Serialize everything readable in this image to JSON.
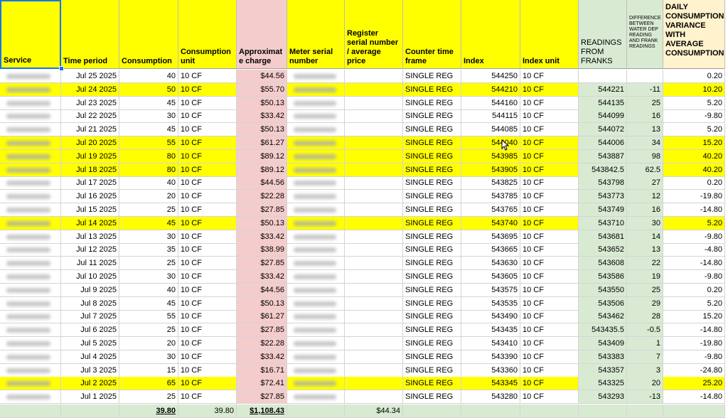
{
  "columns": [
    {
      "key": "service",
      "label": "Service"
    },
    {
      "key": "period",
      "label": "Time period"
    },
    {
      "key": "consumption",
      "label": "Consumption"
    },
    {
      "key": "unit",
      "label": "Consumption unit"
    },
    {
      "key": "charge",
      "label": "Approximat e charge"
    },
    {
      "key": "meter",
      "label": "Meter serial number"
    },
    {
      "key": "register",
      "label": "Register serial number / average price"
    },
    {
      "key": "counter",
      "label": "Counter time frame"
    },
    {
      "key": "index",
      "label": "Index"
    },
    {
      "key": "index_unit",
      "label": "Index unit"
    },
    {
      "key": "franks",
      "label": "READINGS FROM FRANKS"
    },
    {
      "key": "diff",
      "label": "DIFFERENCE BETWEEN WATER DEP READING AND FRANK READINGS"
    },
    {
      "key": "variance",
      "label": "DAILY CONSUMPTION VARIANCE WITH AVERAGE CONSUMPTION"
    }
  ],
  "rows": [
    {
      "period": "Jul 25 2025",
      "consumption": "40",
      "unit": "10 CF",
      "charge": "$44.56",
      "counter": "SINGLE REG",
      "index": "544250",
      "index_unit": "10 CF",
      "franks": "",
      "diff": "",
      "variance": "0.20",
      "hl": false
    },
    {
      "period": "Jul 24 2025",
      "consumption": "50",
      "unit": "10 CF",
      "charge": "$55.70",
      "counter": "SINGLE REG",
      "index": "544210",
      "index_unit": "10 CF",
      "franks": "544221",
      "diff": "-11",
      "variance": "10.20",
      "hl": true
    },
    {
      "period": "Jul 23 2025",
      "consumption": "45",
      "unit": "10 CF",
      "charge": "$50.13",
      "counter": "SINGLE REG",
      "index": "544160",
      "index_unit": "10 CF",
      "franks": "544135",
      "diff": "25",
      "variance": "5.20",
      "hl": false
    },
    {
      "period": "Jul 22 2025",
      "consumption": "30",
      "unit": "10 CF",
      "charge": "$33.42",
      "counter": "SINGLE REG",
      "index": "544115",
      "index_unit": "10 CF",
      "franks": "544099",
      "diff": "16",
      "variance": "-9.80",
      "hl": false
    },
    {
      "period": "Jul 21 2025",
      "consumption": "45",
      "unit": "10 CF",
      "charge": "$50.13",
      "counter": "SINGLE REG",
      "index": "544085",
      "index_unit": "10 CF",
      "franks": "544072",
      "diff": "13",
      "variance": "5.20",
      "hl": false
    },
    {
      "period": "Jul 20 2025",
      "consumption": "55",
      "unit": "10 CF",
      "charge": "$61.27",
      "counter": "SINGLE REG",
      "index": "544040",
      "index_unit": "10 CF",
      "franks": "544006",
      "diff": "34",
      "variance": "15.20",
      "hl": true
    },
    {
      "period": "Jul 19 2025",
      "consumption": "80",
      "unit": "10 CF",
      "charge": "$89.12",
      "counter": "SINGLE REG",
      "index": "543985",
      "index_unit": "10 CF",
      "franks": "543887",
      "diff": "98",
      "variance": "40.20",
      "hl": true
    },
    {
      "period": "Jul 18 2025",
      "consumption": "80",
      "unit": "10 CF",
      "charge": "$89.12",
      "counter": "SINGLE REG",
      "index": "543905",
      "index_unit": "10 CF",
      "franks": "543842.5",
      "diff": "62.5",
      "variance": "40.20",
      "hl": true
    },
    {
      "period": "Jul 17 2025",
      "consumption": "40",
      "unit": "10 CF",
      "charge": "$44.56",
      "counter": "SINGLE REG",
      "index": "543825",
      "index_unit": "10 CF",
      "franks": "543798",
      "diff": "27",
      "variance": "0.20",
      "hl": false
    },
    {
      "period": "Jul 16 2025",
      "consumption": "20",
      "unit": "10 CF",
      "charge": "$22.28",
      "counter": "SINGLE REG",
      "index": "543785",
      "index_unit": "10 CF",
      "franks": "543773",
      "diff": "12",
      "variance": "-19.80",
      "hl": false
    },
    {
      "period": "Jul 15 2025",
      "consumption": "25",
      "unit": "10 CF",
      "charge": "$27.85",
      "counter": "SINGLE REG",
      "index": "543765",
      "index_unit": "10 CF",
      "franks": "543749",
      "diff": "16",
      "variance": "-14.80",
      "hl": false
    },
    {
      "period": "Jul 14 2025",
      "consumption": "45",
      "unit": "10 CF",
      "charge": "$50.13",
      "counter": "SINGLE REG",
      "index": "543740",
      "index_unit": "10 CF",
      "franks": "543710",
      "diff": "30",
      "variance": "5.20",
      "hl": true
    },
    {
      "period": "Jul 13 2025",
      "consumption": "30",
      "unit": "10 CF",
      "charge": "$33.42",
      "counter": "SINGLE REG",
      "index": "543695",
      "index_unit": "10 CF",
      "franks": "543681",
      "diff": "14",
      "variance": "-9.80",
      "hl": false
    },
    {
      "period": "Jul 12 2025",
      "consumption": "35",
      "unit": "10 CF",
      "charge": "$38.99",
      "counter": "SINGLE REG",
      "index": "543665",
      "index_unit": "10 CF",
      "franks": "543652",
      "diff": "13",
      "variance": "-4.80",
      "hl": false
    },
    {
      "period": "Jul 11 2025",
      "consumption": "25",
      "unit": "10 CF",
      "charge": "$27.85",
      "counter": "SINGLE REG",
      "index": "543630",
      "index_unit": "10 CF",
      "franks": "543608",
      "diff": "22",
      "variance": "-14.80",
      "hl": false
    },
    {
      "period": "Jul 10 2025",
      "consumption": "30",
      "unit": "10 CF",
      "charge": "$33.42",
      "counter": "SINGLE REG",
      "index": "543605",
      "index_unit": "10 CF",
      "franks": "543586",
      "diff": "19",
      "variance": "-9.80",
      "hl": false
    },
    {
      "period": "Jul 9 2025",
      "consumption": "40",
      "unit": "10 CF",
      "charge": "$44.56",
      "counter": "SINGLE REG",
      "index": "543575",
      "index_unit": "10 CF",
      "franks": "543550",
      "diff": "25",
      "variance": "0.20",
      "hl": false
    },
    {
      "period": "Jul 8 2025",
      "consumption": "45",
      "unit": "10 CF",
      "charge": "$50.13",
      "counter": "SINGLE REG",
      "index": "543535",
      "index_unit": "10 CF",
      "franks": "543506",
      "diff": "29",
      "variance": "5.20",
      "hl": false
    },
    {
      "period": "Jul 7 2025",
      "consumption": "55",
      "unit": "10 CF",
      "charge": "$61.27",
      "counter": "SINGLE REG",
      "index": "543490",
      "index_unit": "10 CF",
      "franks": "543462",
      "diff": "28",
      "variance": "15.20",
      "hl": false
    },
    {
      "period": "Jul 6 2025",
      "consumption": "25",
      "unit": "10 CF",
      "charge": "$27.85",
      "counter": "SINGLE REG",
      "index": "543435",
      "index_unit": "10 CF",
      "franks": "543435.5",
      "diff": "-0.5",
      "variance": "-14.80",
      "hl": false
    },
    {
      "period": "Jul 5 2025",
      "consumption": "20",
      "unit": "10 CF",
      "charge": "$22.28",
      "counter": "SINGLE REG",
      "index": "543410",
      "index_unit": "10 CF",
      "franks": "543409",
      "diff": "1",
      "variance": "-19.80",
      "hl": false
    },
    {
      "period": "Jul 4 2025",
      "consumption": "30",
      "unit": "10 CF",
      "charge": "$33.42",
      "counter": "SINGLE REG",
      "index": "543390",
      "index_unit": "10 CF",
      "franks": "543383",
      "diff": "7",
      "variance": "-9.80",
      "hl": false
    },
    {
      "period": "Jul 3 2025",
      "consumption": "15",
      "unit": "10 CF",
      "charge": "$16.71",
      "counter": "SINGLE REG",
      "index": "543360",
      "index_unit": "10 CF",
      "franks": "543357",
      "diff": "3",
      "variance": "-24.80",
      "hl": false
    },
    {
      "period": "Jul 2 2025",
      "consumption": "65",
      "unit": "10 CF",
      "charge": "$72.41",
      "counter": "SINGLE REG",
      "index": "543345",
      "index_unit": "10 CF",
      "franks": "543325",
      "diff": "20",
      "variance": "25.20",
      "hl": true
    },
    {
      "period": "Jul 1 2025",
      "consumption": "25",
      "unit": "10 CF",
      "charge": "$27.85",
      "counter": "SINGLE REG",
      "index": "543280",
      "index_unit": "10 CF",
      "franks": "543293",
      "diff": "-13",
      "variance": "-14.80",
      "hl": false
    }
  ],
  "totals": {
    "consumption": "39.80",
    "unit": "39.80",
    "charge": "$1,108.43",
    "register": "$44.34"
  },
  "colors": {
    "highlight": "#ffff00",
    "charge_bg": "#f4cccc",
    "franks_bg": "#d9ead3",
    "variance_header_bg": "#fff2cc"
  }
}
